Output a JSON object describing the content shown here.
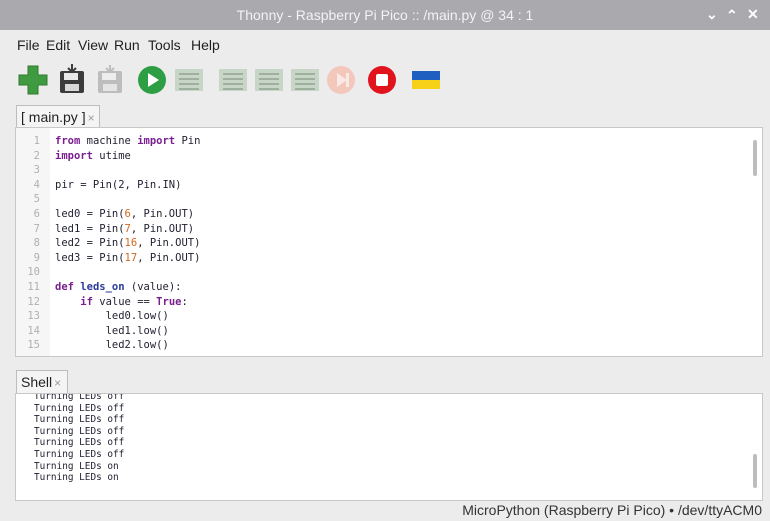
{
  "window": {
    "title": "Thonny  -  Raspberry Pi Pico :: /main.py  @  34 : 1"
  },
  "menu": [
    "File",
    "Edit",
    "View",
    "Run",
    "Tools",
    "Help"
  ],
  "toolbar": {
    "buttons": [
      {
        "icon": "new-file-icon"
      },
      {
        "icon": "open-file-icon"
      },
      {
        "icon": "save-file-icon"
      },
      {
        "icon": "run-icon"
      },
      {
        "icon": "debug-icon"
      },
      {
        "icon": "step-over-icon"
      },
      {
        "icon": "step-into-icon"
      },
      {
        "icon": "step-out-icon"
      },
      {
        "icon": "resume-icon"
      },
      {
        "icon": "stop-icon"
      },
      {
        "icon": "ukraine-flag-icon"
      }
    ]
  },
  "editor": {
    "tab_label": "[ main.py ]",
    "tab_close": "×",
    "lines": [
      [
        {
          "t": "from",
          "c": "kw"
        },
        {
          "t": " machine "
        },
        {
          "t": "import",
          "c": "kw"
        },
        {
          "t": " Pin"
        }
      ],
      [
        {
          "t": "import",
          "c": "kw"
        },
        {
          "t": " utime"
        }
      ],
      [],
      [
        {
          "t": "pir = Pin(2, Pin.IN)"
        }
      ],
      [],
      [
        {
          "t": "led0 = Pin("
        },
        {
          "t": "6",
          "c": "num"
        },
        {
          "t": ", Pin.OUT)"
        }
      ],
      [
        {
          "t": "led1 = Pin("
        },
        {
          "t": "7",
          "c": "num"
        },
        {
          "t": ", Pin.OUT)"
        }
      ],
      [
        {
          "t": "led2 = Pin("
        },
        {
          "t": "16",
          "c": "num"
        },
        {
          "t": ", Pin.OUT)"
        }
      ],
      [
        {
          "t": "led3 = Pin("
        },
        {
          "t": "17",
          "c": "num"
        },
        {
          "t": ", Pin.OUT)"
        }
      ],
      [],
      [
        {
          "t": "def",
          "c": "kw"
        },
        {
          "t": " "
        },
        {
          "t": "leds_on",
          "c": "fn"
        },
        {
          "t": " (value):"
        }
      ],
      [
        {
          "t": "    "
        },
        {
          "t": "if",
          "c": "kw"
        },
        {
          "t": " value == "
        },
        {
          "t": "True",
          "c": "kw"
        },
        {
          "t": ":"
        }
      ],
      [
        {
          "t": "        led0.low()"
        }
      ],
      [
        {
          "t": "        led1.low()"
        }
      ],
      [
        {
          "t": "        led2.low()"
        }
      ]
    ]
  },
  "shell": {
    "tab_label": "Shell",
    "tab_close": "×",
    "lines": [
      "Turning LEDs off",
      "Turning LEDs off",
      "Turning LEDs off",
      "Turning LEDs off",
      "Turning LEDs off",
      "Turning LEDs off",
      "Turning LEDs on",
      "Turning LEDs on"
    ]
  },
  "status": {
    "interpreter": "MicroPython (Raspberry Pi Pico)  •  /dev/ttyACM0"
  },
  "colors": {
    "titlebar": "#a9a9ae",
    "run_green": "#2e9e44",
    "stop_red": "#e1141e",
    "add_green": "#3f9b3f",
    "flag_blue": "#1e5fbf",
    "flag_yellow": "#f7d117"
  }
}
